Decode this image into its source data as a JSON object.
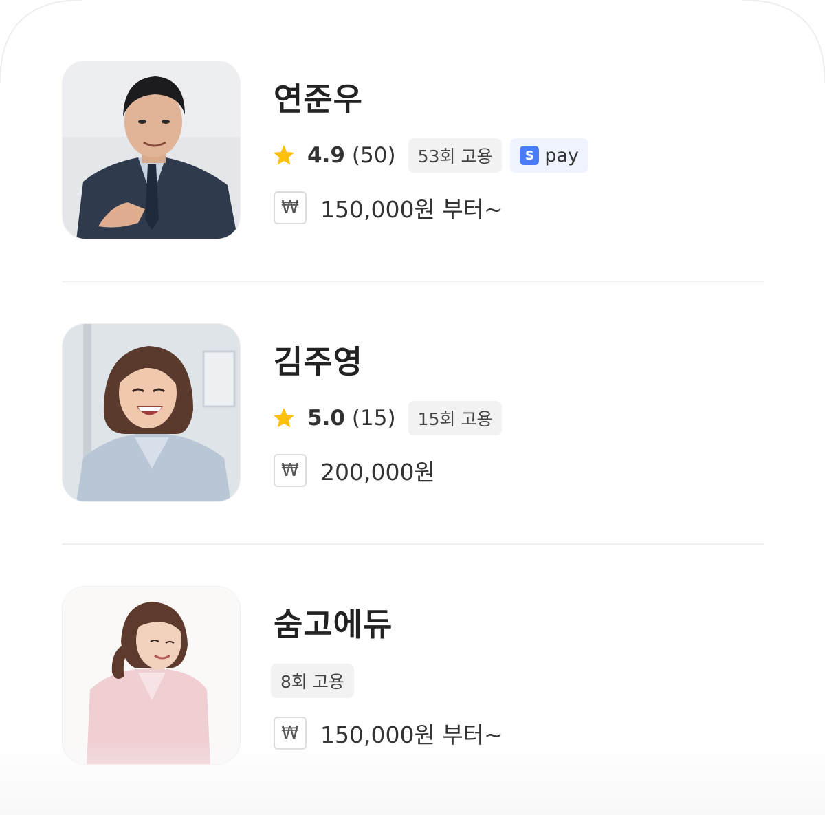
{
  "colors": {
    "star": "#ffc107",
    "divider": "#eeeeee",
    "badge_bg": "#f2f2f2",
    "pay_bg": "#eef3ff",
    "pay_icon": "#4a7cf7"
  },
  "providers": [
    {
      "name": "연준우",
      "rating": "4.9",
      "reviews": "(50)",
      "hires": "53회 고용",
      "pay_label": "pay",
      "pay_icon_glyph": "S",
      "currency_icon": "₩",
      "price": "150,000원 부터~",
      "avatar": "man-in-suit-photo"
    },
    {
      "name": "김주영",
      "rating": "5.0",
      "reviews": "(15)",
      "hires": "15회 고용",
      "currency_icon": "₩",
      "price": "200,000원",
      "avatar": "smiling-woman-photo"
    },
    {
      "name": "숨고에듀",
      "hires": "8회 고용",
      "currency_icon": "₩",
      "price": "150,000원 부터~",
      "avatar": "woman-pink-shirt-photo"
    }
  ]
}
